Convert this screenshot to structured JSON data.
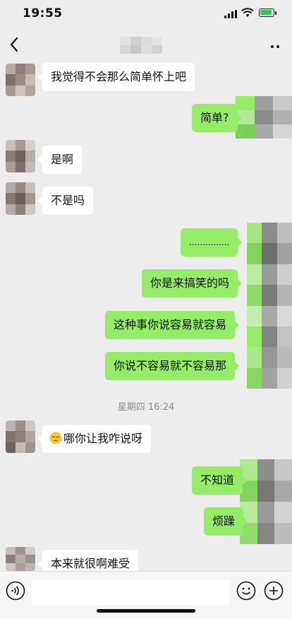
{
  "status": {
    "time": "19:55"
  },
  "nav": {
    "back_label": "<",
    "more_label": "··"
  },
  "messages": [
    {
      "side": "in",
      "text": "我觉得不会那么简单怀上吧"
    },
    {
      "side": "out",
      "text": "简单?"
    },
    {
      "side": "in",
      "text": "是啊"
    },
    {
      "side": "in",
      "text": "不是吗"
    },
    {
      "side": "out",
      "text": "..............."
    },
    {
      "side": "out",
      "text": "你是来搞笑的吗"
    },
    {
      "side": "out",
      "text": "这种事你说容易就容易"
    },
    {
      "side": "out",
      "text": "你说不容易就不容易那"
    },
    {
      "side": "in",
      "text": "哪你让我咋说呀",
      "emoji": "pensive-face"
    },
    {
      "side": "out",
      "text": "不知道"
    },
    {
      "side": "out",
      "text": "烦躁"
    },
    {
      "side": "in",
      "text": "本来就很啊难受"
    }
  ],
  "timestamp": "星期四 16:24",
  "colors": {
    "outgoing_bubble": "#95ec69",
    "incoming_bubble": "#ffffff",
    "background": "#ededed"
  },
  "icons": {
    "back": "chevron-left-icon",
    "more": "more-dots-icon",
    "voice": "voice-icon",
    "emoji": "emoji-icon",
    "plus": "plus-icon"
  }
}
